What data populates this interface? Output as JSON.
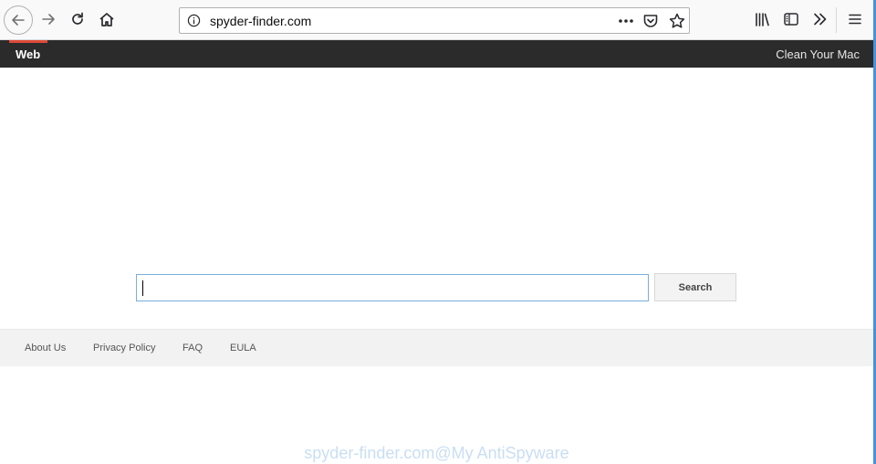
{
  "browser": {
    "url": "spyder-finder.com",
    "icons": {
      "back": "arrow-left-icon",
      "forward": "arrow-right-icon",
      "reload": "reload-icon",
      "home": "home-icon",
      "info": "info-icon",
      "more": "ellipsis-icon",
      "pocket": "pocket-icon",
      "bookmark": "star-icon",
      "library": "library-icon",
      "sidebar": "sidebar-icon",
      "overflow": "chevron-double-right-icon",
      "menu": "hamburger-icon"
    }
  },
  "site": {
    "nav": {
      "active_tab": "Web",
      "right_link": "Clean Your Mac"
    },
    "search": {
      "value": "",
      "button_label": "Search"
    },
    "footer": {
      "links": [
        "About Us",
        "Privacy Policy",
        "FAQ",
        "EULA"
      ]
    },
    "colors": {
      "header_bg": "#2b2b2b",
      "tab_indicator": "#dd4b39",
      "input_border": "#7aaedb",
      "footer_bg": "#f2f2f2"
    }
  },
  "watermark": "spyder-finder.com@My AntiSpyware"
}
